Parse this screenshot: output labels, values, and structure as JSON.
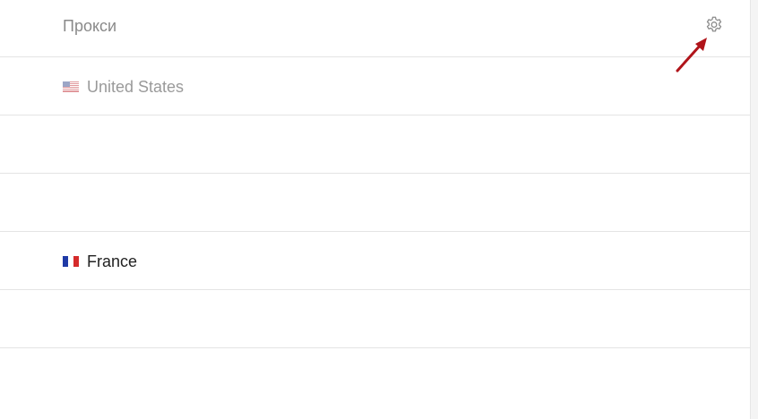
{
  "header": {
    "title": "Прокси",
    "settings_icon": "gear-icon"
  },
  "proxies": [
    {
      "country": "United States",
      "flag": "us-flag-icon",
      "state": "muted"
    },
    {
      "country": "",
      "flag": "",
      "state": "empty"
    },
    {
      "country": "",
      "flag": "",
      "state": "empty"
    },
    {
      "country": "France",
      "flag": "fr-flag-icon",
      "state": "active"
    },
    {
      "country": "",
      "flag": "",
      "state": "empty"
    }
  ],
  "annotation": {
    "type": "arrow",
    "color": "#b0141a",
    "points_to": "settings-button"
  },
  "colors": {
    "muted_text": "#8a8a8a",
    "active_text": "#222222",
    "divider": "#e4e4e4"
  }
}
